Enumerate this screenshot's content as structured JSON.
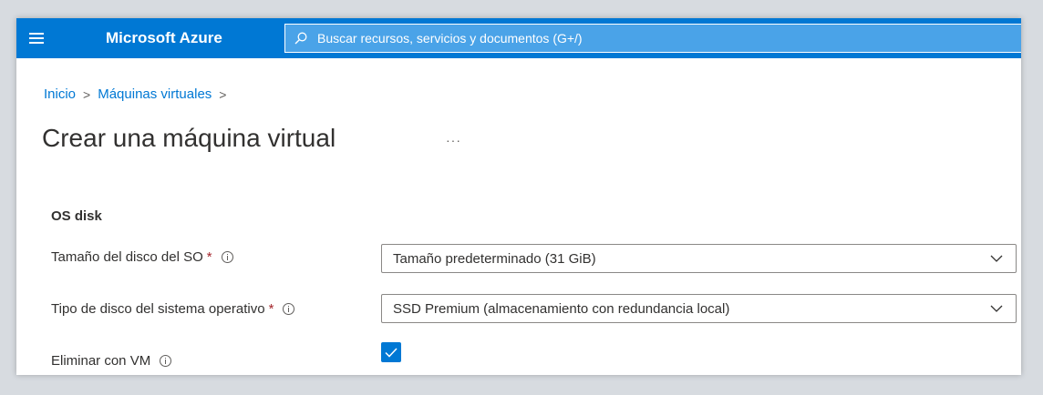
{
  "topbar": {
    "brand": "Microsoft Azure",
    "search_placeholder": "Buscar recursos, servicios y documentos (G+/)",
    "color": "#0078d4"
  },
  "breadcrumb": {
    "items": [
      "Inicio",
      "Máquinas virtuales"
    ],
    "separator": ">"
  },
  "page": {
    "title": "Crear una máquina virtual",
    "more": "···"
  },
  "os_disk": {
    "section_title": "OS disk",
    "size_label": "Tamaño del disco del SO",
    "size_value": "Tamaño predeterminado (31 GiB)",
    "type_label": "Tipo de disco del sistema operativo",
    "type_value": "SSD Premium (almacenamiento con redundancia local)",
    "delete_label": "Eliminar con VM",
    "delete_checked": true,
    "required_mark": "*"
  },
  "icons": [
    "hamburger-icon",
    "search-icon",
    "info-icon",
    "chevron-down-icon",
    "checkmark-icon"
  ]
}
